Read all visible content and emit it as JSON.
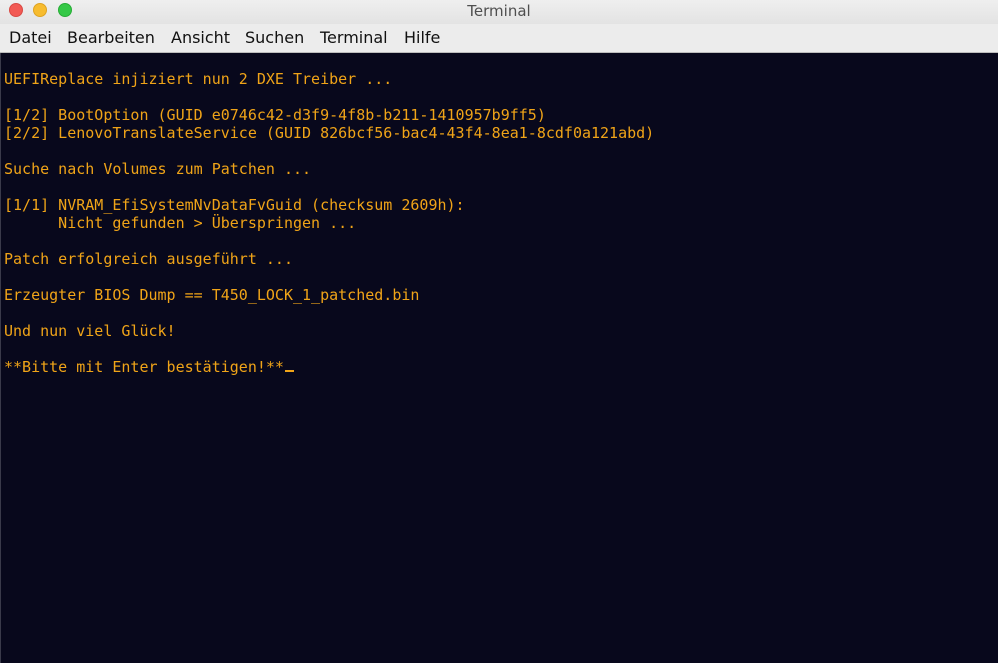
{
  "window": {
    "title": "Terminal",
    "traffic_lights": {
      "close_color": "#f25a54",
      "minimize_color": "#f7bc2f",
      "maximize_color": "#35c847"
    }
  },
  "menubar": {
    "items": [
      {
        "label": "Datei"
      },
      {
        "label": "Bearbeiten"
      },
      {
        "label": "Ansicht"
      },
      {
        "label": "Suchen"
      },
      {
        "label": "Terminal"
      },
      {
        "label": "Hilfe"
      }
    ]
  },
  "terminal": {
    "background_color": "#08081c",
    "text_color": "#f0a418",
    "lines": [
      "UEFIReplace injiziert nun 2 DXE Treiber ...",
      "[1/2] BootOption (GUID e0746c42-d3f9-4f8b-b211-1410957b9ff5)",
      "[2/2] LenovoTranslateService (GUID 826bcf56-bac4-43f4-8ea1-8cdf0a121abd)",
      "Suche nach Volumes zum Patchen ...",
      "[1/1] NVRAM_EfiSystemNvDataFvGuid (checksum 2609h):",
      "      Nicht gefunden > Überspringen ...",
      "Patch erfolgreich ausgeführt ...",
      "Erzeugter BIOS Dump == T450_LOCK_1_patched.bin",
      "Und nun viel Glück!",
      "**Bitte mit Enter bestätigen!**"
    ]
  }
}
